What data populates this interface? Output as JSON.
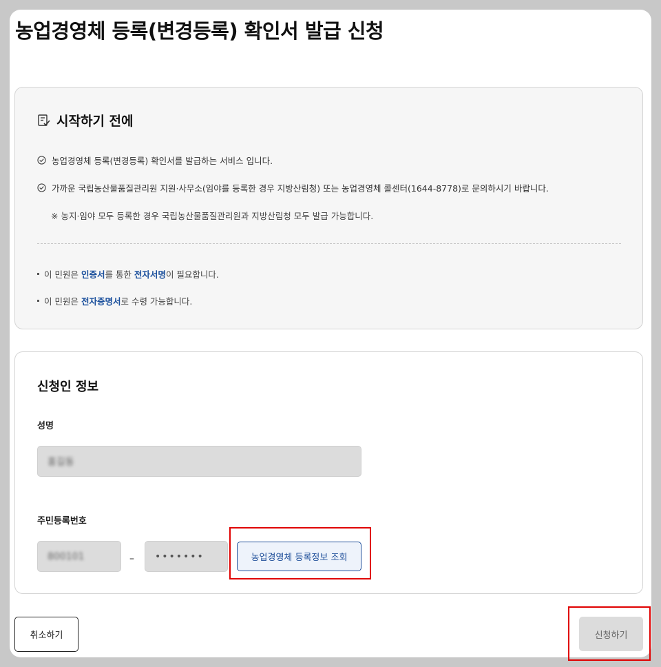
{
  "page": {
    "title": "농업경영체 등록(변경등록) 확인서 발급 신청"
  },
  "intro": {
    "heading": "시작하기 전에",
    "lines": [
      "농업경영체 등록(변경등록) 확인서를 발급하는 서비스 입니다.",
      "가까운 국립농산물품질관리원 지원·사무소(임야를 등록한 경우 지방산림청) 또는 농업경영체 콜센터(1644-8778)로 문의하시기 바랍니다."
    ],
    "note": "※ 농지·임야 모두 등록한 경우 국립농산물품질관리원과 지방산림청 모두 발급 가능합니다.",
    "bullet1": {
      "pre": "이 민원은 ",
      "hl1": "인증서",
      "mid": "를 통한 ",
      "hl2": "전자서명",
      "post": "이 필요합니다."
    },
    "bullet2": {
      "pre": "이 민원은 ",
      "hl1": "전자증명서",
      "post": "로 수령 가능합니다."
    }
  },
  "form": {
    "heading": "신청인 정보",
    "name_label": "성명",
    "name_value": "홍길동",
    "rrn_label": "주민등록번호",
    "rrn_front": "800101",
    "rrn_dash": "–",
    "rrn_back": "•••••••",
    "lookup_button": "농업경영체 등록정보 조회"
  },
  "actions": {
    "cancel": "취소하기",
    "submit": "신청하기"
  },
  "colors": {
    "accent": "#1f4f9a",
    "highlight": "#e00000"
  }
}
